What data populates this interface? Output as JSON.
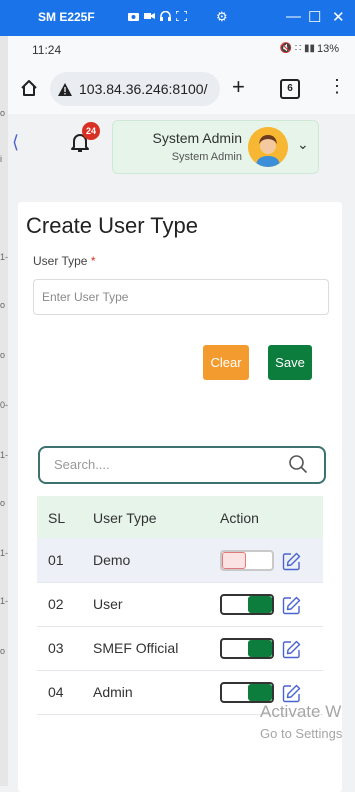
{
  "window": {
    "device_name": "SM E225F"
  },
  "status_bar": {
    "time": "11:24",
    "battery": "13%"
  },
  "browser": {
    "url": "103.84.36.246:8100/",
    "tab_count": "6"
  },
  "notifications": {
    "count": "24"
  },
  "user": {
    "name": "System Admin",
    "role": "System Admin"
  },
  "form": {
    "title": "Create User Type",
    "label": "User Type",
    "required_mark": "*",
    "placeholder": "Enter User Type",
    "clear_label": "Clear",
    "save_label": "Save"
  },
  "search": {
    "placeholder": "Search...."
  },
  "table": {
    "headers": {
      "sl": "SL",
      "type": "User Type",
      "action": "Action"
    },
    "rows": [
      {
        "sl": "01",
        "type": "Demo",
        "active": false
      },
      {
        "sl": "02",
        "type": "User",
        "active": true
      },
      {
        "sl": "03",
        "type": "SMEF Official",
        "active": true
      },
      {
        "sl": "04",
        "type": "Admin",
        "active": true
      }
    ]
  },
  "watermark": {
    "line1": "Activate W",
    "line2": "Go to Settings"
  },
  "colors": {
    "accent": "#0d7d3d",
    "clear": "#f49b30",
    "badge": "#d93025",
    "window": "#1a73e8"
  }
}
